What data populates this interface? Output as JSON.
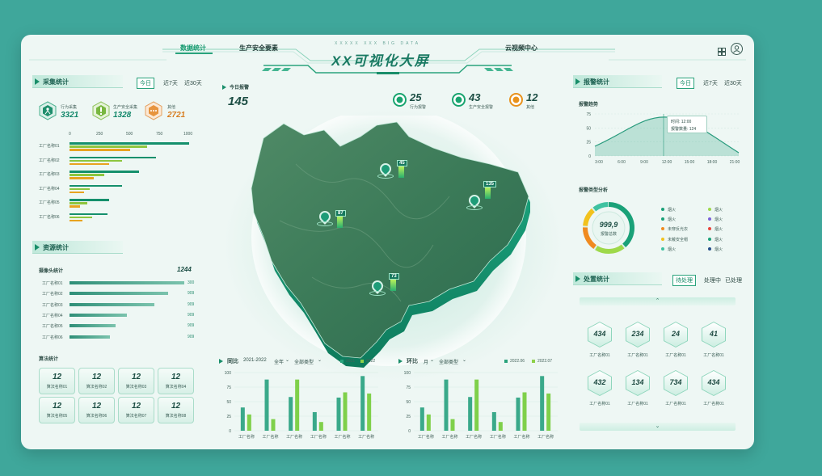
{
  "header": {
    "nav_left": [
      "数据统计",
      "生产安全要素"
    ],
    "nav_right": "云视频中心",
    "title": "XX可视化大屏",
    "subtitle": "XXXXX XXX BIG DATA",
    "icons": [
      "grid-icon",
      "user-icon"
    ]
  },
  "filters": [
    "今日",
    "近7天",
    "近30天"
  ],
  "collection": {
    "title": "采集统计",
    "stats": [
      {
        "label": "行为采集",
        "value": "3321",
        "color": "#15906c"
      },
      {
        "label": "生产安全采集",
        "value": "1328",
        "color": "#15906c"
      },
      {
        "label": "其他",
        "value": "2721",
        "color": "#d77d20"
      }
    ],
    "axis": [
      "0",
      "250",
      "500",
      "750",
      "1000"
    ],
    "rows": [
      {
        "name": "工厂名称01",
        "values": [
          1000,
          650,
          510
        ]
      },
      {
        "name": "工厂名称02",
        "values": [
          720,
          440,
          330
        ]
      },
      {
        "name": "工厂名称03",
        "values": [
          580,
          290,
          200
        ]
      },
      {
        "name": "工厂名称04",
        "values": [
          440,
          170,
          120
        ]
      },
      {
        "name": "工厂名称05",
        "values": [
          330,
          150,
          90
        ]
      },
      {
        "name": "工厂名称06",
        "values": [
          320,
          190,
          110
        ]
      }
    ]
  },
  "resources": {
    "title": "资源统计",
    "camera_label": "摄像头统计",
    "camera_total": "1244",
    "rows": [
      {
        "name": "工厂名称01",
        "value": "300",
        "fill": 1.0
      },
      {
        "name": "工厂名称02",
        "value": "909",
        "fill": 0.86
      },
      {
        "name": "工厂名称03",
        "value": "909",
        "fill": 0.74
      },
      {
        "name": "工厂名称04",
        "value": "909",
        "fill": 0.5
      },
      {
        "name": "工厂名称05",
        "value": "909",
        "fill": 0.4
      },
      {
        "name": "工厂名称06",
        "value": "909",
        "fill": 0.35
      }
    ],
    "algo_label": "算法统计",
    "algos": [
      {
        "value": "12",
        "label": "算法名称01"
      },
      {
        "value": "12",
        "label": "算法名称02"
      },
      {
        "value": "12",
        "label": "算法名称03"
      },
      {
        "value": "12",
        "label": "算法名称04"
      },
      {
        "value": "12",
        "label": "算法名称05"
      },
      {
        "value": "12",
        "label": "算法名称06"
      },
      {
        "value": "12",
        "label": "算法名称07"
      },
      {
        "value": "12",
        "label": "算法名称08"
      }
    ]
  },
  "center": {
    "today_label": "今日报警",
    "today_value": "145",
    "top_stats": [
      {
        "value": "25",
        "label": "行为报警",
        "color": "#19a46f"
      },
      {
        "value": "43",
        "label": "生产安全报警",
        "color": "#19a46f"
      },
      {
        "value": "12",
        "label": "其他",
        "color": "#e8921c"
      }
    ],
    "markers": [
      "45",
      "135",
      "87",
      "73"
    ]
  },
  "yoy": {
    "title": "同比",
    "range": "2021-2022",
    "period": "全年",
    "type": "全部类型",
    "legend": [
      "2021",
      "2022"
    ],
    "yticks": [
      "0",
      "25",
      "50",
      "75",
      "100"
    ],
    "categories": [
      "工厂名称",
      "工厂名称",
      "工厂名称",
      "工厂名称",
      "工厂名称",
      "工厂名称"
    ],
    "series_a": [
      40,
      88,
      58,
      32,
      57,
      94
    ],
    "series_b": [
      28,
      20,
      88,
      15,
      66,
      64
    ]
  },
  "mom": {
    "title": "环比",
    "period": "月",
    "type": "全部类型",
    "legend": [
      "2022.06",
      "2022.07"
    ],
    "yticks": [
      "0",
      "25",
      "50",
      "75",
      "100"
    ],
    "categories": [
      "工厂名称",
      "工厂名称",
      "工厂名称",
      "工厂名称",
      "工厂名称",
      "工厂名称"
    ],
    "series_a": [
      40,
      88,
      58,
      32,
      57,
      94
    ],
    "series_b": [
      28,
      20,
      88,
      15,
      66,
      64
    ]
  },
  "alarm": {
    "title": "报警统计",
    "trend_label": "报警趋势",
    "yticks": [
      "0",
      "25",
      "50",
      "75"
    ],
    "xticks": [
      "3:00",
      "6:00",
      "9:00",
      "12:00",
      "15:00",
      "18:00",
      "21:00"
    ],
    "tooltip_time": "时间: 12:00",
    "tooltip_count": "报警数量: 124",
    "type_label": "报警类型分析",
    "donut_value": "999,9",
    "donut_label": "报警总数",
    "types": [
      {
        "name": "烟火",
        "color": "#1aa178"
      },
      {
        "name": "烟火",
        "color": "#9ed94a"
      },
      {
        "name": "烟火",
        "color": "#1aa178"
      },
      {
        "name": "烟火",
        "color": "#7a61d9"
      },
      {
        "name": "未穿反光衣",
        "color": "#f08a1f"
      },
      {
        "name": "烟火",
        "color": "#e8453c"
      },
      {
        "name": "未戴安全帽",
        "color": "#f2c21d"
      },
      {
        "name": "烟火",
        "color": "#1aa178"
      },
      {
        "name": "烟火",
        "color": "#3fc2a1"
      },
      {
        "name": "烟火",
        "color": "#264e8a"
      }
    ]
  },
  "handling": {
    "title": "处置统计",
    "tabs": [
      "待处理",
      "处理中",
      "已处理"
    ],
    "items": [
      {
        "value": "434",
        "label": "工厂名称01"
      },
      {
        "value": "234",
        "label": "工厂名称01"
      },
      {
        "value": "24",
        "label": "工厂名称01"
      },
      {
        "value": "41",
        "label": "工厂名称01"
      },
      {
        "value": "432",
        "label": "工厂名称01"
      },
      {
        "value": "134",
        "label": "工厂名称01"
      },
      {
        "value": "734",
        "label": "工厂名称01"
      },
      {
        "value": "434",
        "label": "工厂名称01"
      }
    ]
  }
}
